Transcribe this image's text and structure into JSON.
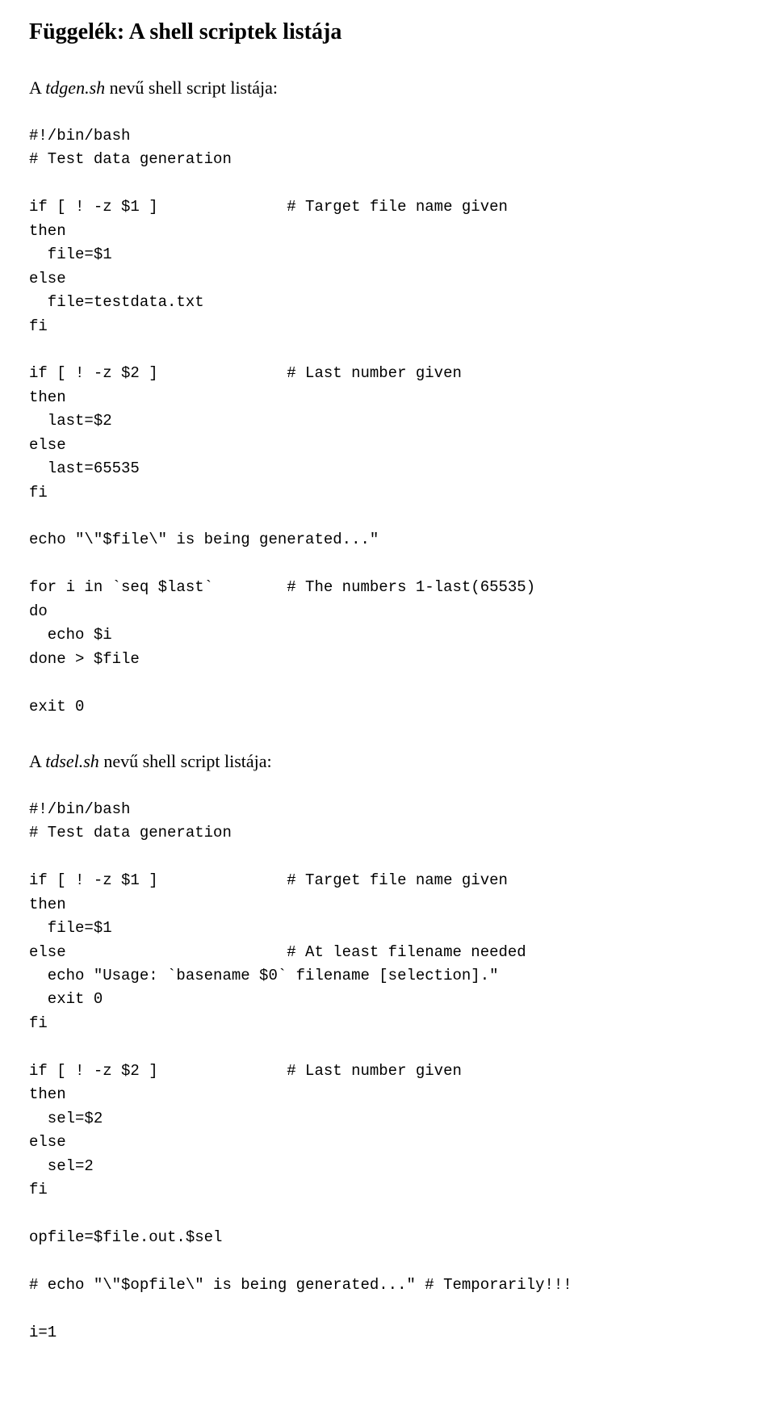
{
  "title": "Függelék: A shell scriptek listája",
  "script1": {
    "intro_pre": "A ",
    "intro_name": "tdgen.sh",
    "intro_post": " nevű shell script listája:",
    "code": "#!/bin/bash\n# Test data generation\n\nif [ ! -z $1 ]              # Target file name given\nthen\n  file=$1\nelse\n  file=testdata.txt\nfi\n\nif [ ! -z $2 ]              # Last number given\nthen\n  last=$2\nelse\n  last=65535\nfi\n\necho \"\\\"$file\\\" is being generated...\"\n\nfor i in `seq $last`        # The numbers 1-last(65535)\ndo\n  echo $i\ndone > $file\n\nexit 0"
  },
  "script2": {
    "intro_pre": "A ",
    "intro_name": "tdsel.sh",
    "intro_post": " nevű shell script listája:",
    "code": "#!/bin/bash\n# Test data generation\n\nif [ ! -z $1 ]              # Target file name given\nthen\n  file=$1\nelse                        # At least filename needed\n  echo \"Usage: `basename $0` filename [selection].\"\n  exit 0\nfi\n\nif [ ! -z $2 ]              # Last number given\nthen\n  sel=$2\nelse\n  sel=2\nfi\n\nopfile=$file.out.$sel\n\n# echo \"\\\"$opfile\\\" is being generated...\" # Temporarily!!!\n\ni=1"
  }
}
